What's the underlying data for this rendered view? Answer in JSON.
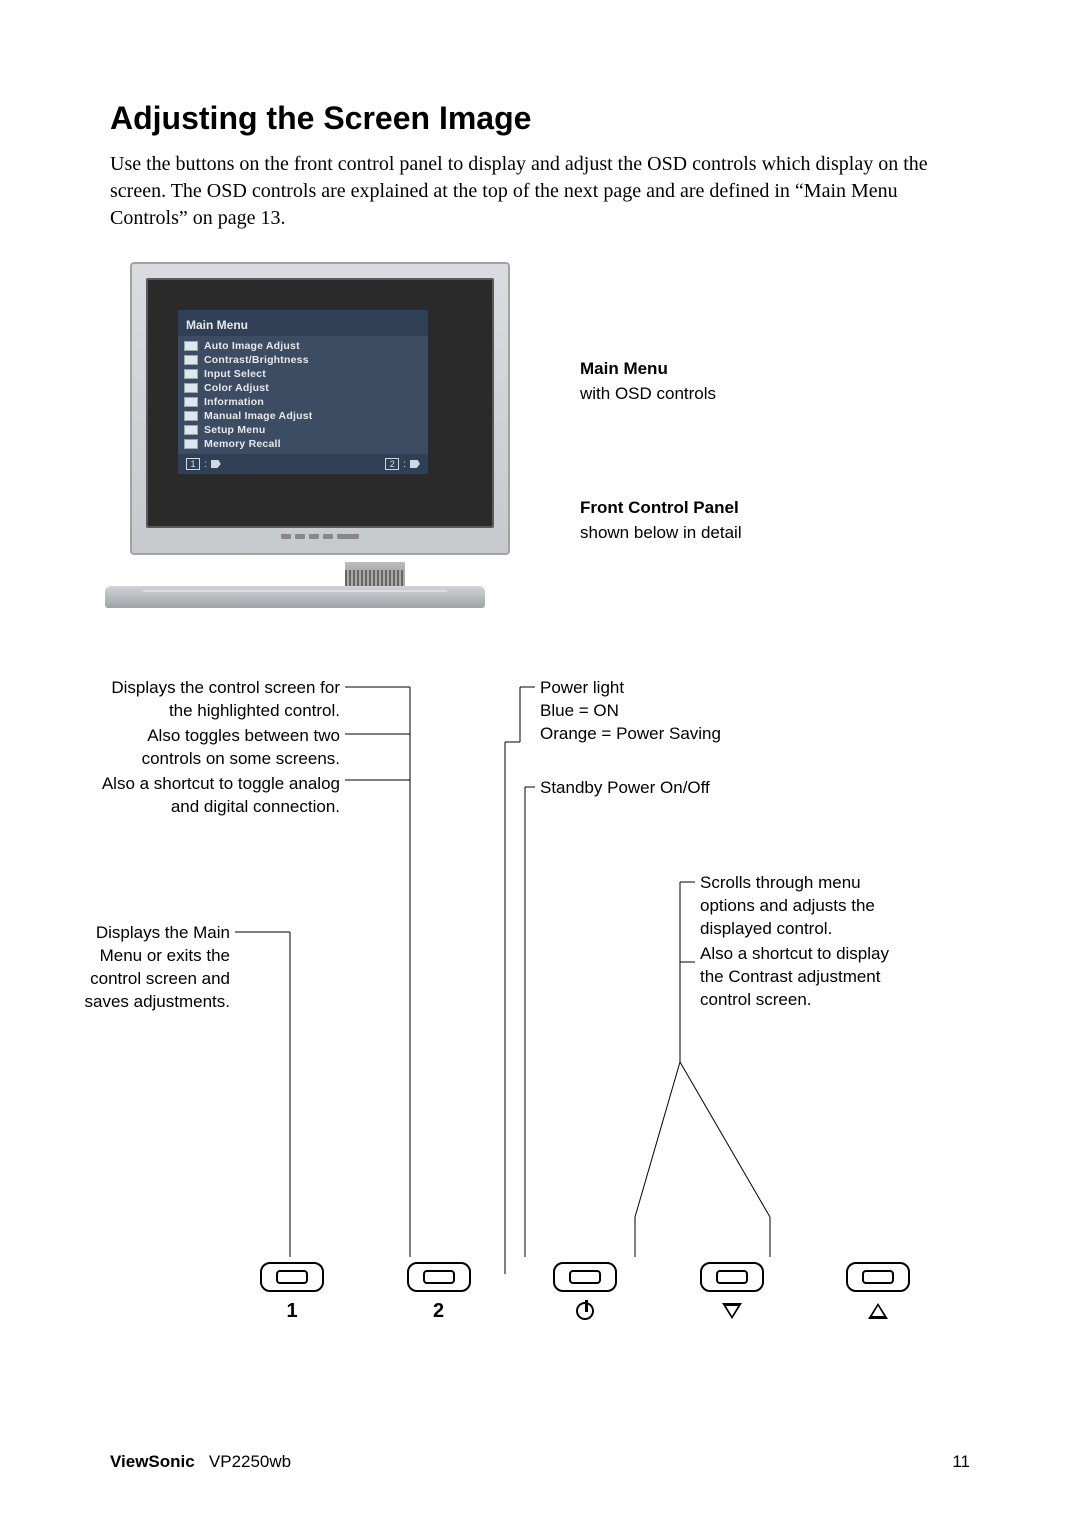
{
  "heading": "Adjusting the Screen Image",
  "intro": "Use the buttons on the front control panel to display and adjust the OSD controls which display on the screen. The OSD controls are explained at the top of the next page and are defined in “Main Menu Controls” on page 13.",
  "osd": {
    "title": "Main Menu",
    "items": [
      "Auto Image Adjust",
      "Contrast/Brightness",
      "Input Select",
      "Color Adjust",
      "Information",
      "Manual Image Adjust",
      "Setup Menu",
      "Memory Recall"
    ],
    "footer_left": "1",
    "footer_right": "2"
  },
  "side": {
    "mm_title": "Main Menu",
    "mm_sub": "with OSD controls",
    "fcp_title": "Front Control Panel",
    "fcp_sub": "shown below in detail"
  },
  "callouts": {
    "btn2_a": "Displays the control screen for the highlighted control.",
    "btn2_b": "Also toggles between two controls on some screens.",
    "btn2_c": "Also a shortcut to toggle analog and digital connection.",
    "btn1": "Displays the Main Menu or exits the control screen and saves adjustments.",
    "power_a": "Power light",
    "power_b": "Blue = ON",
    "power_c": "Orange = Power Saving",
    "standby": "Standby Power On/Off",
    "scroll_a": "Scrolls through menu options and adjusts the displayed control.",
    "scroll_b": "Also a shortcut to display the Contrast adjustment control screen."
  },
  "buttons": {
    "b1": "1",
    "b2": "2"
  },
  "footer": {
    "brand": "ViewSonic",
    "model": "VP2250wb",
    "page": "11"
  }
}
